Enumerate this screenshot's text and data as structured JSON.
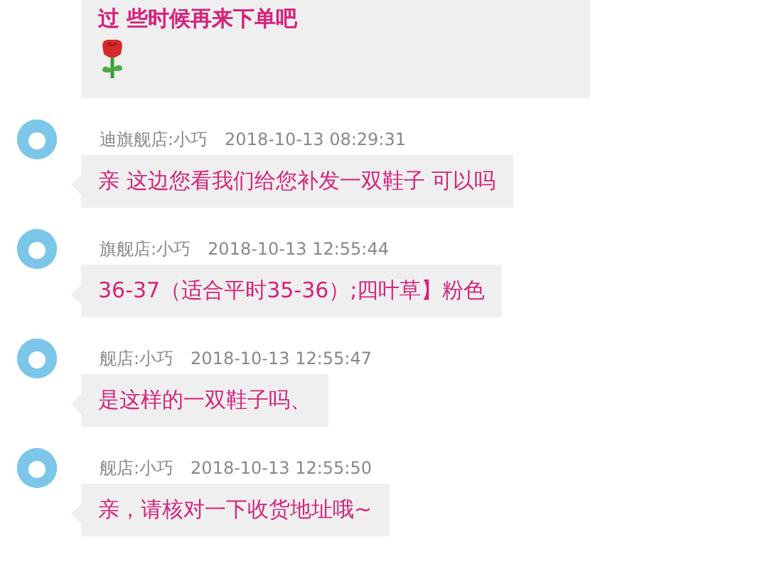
{
  "messages": [
    {
      "text": "过 些时候再来下单吧",
      "bold": true,
      "sticker": true
    },
    {
      "sender": "迪旗舰店:小巧",
      "time": "2018-10-13 08:29:31",
      "text": "亲  这边您看我们给您补发一双鞋子 可以吗",
      "bold": false,
      "sticker": false
    },
    {
      "sender": "旗舰店:小巧",
      "time": "2018-10-13 12:55:44",
      "text": "36-37（适合平时35-36）;四叶草】粉色",
      "bold": false,
      "sticker": false
    },
    {
      "sender": "舰店:小巧",
      "time": "2018-10-13 12:55:47",
      "text": "是这样的一双鞋子吗、",
      "bold": false,
      "sticker": false
    },
    {
      "sender": "舰店:小巧",
      "time": "2018-10-13 12:55:50",
      "text": "亲，请核对一下收货地址哦~",
      "bold": false,
      "sticker": false
    }
  ]
}
